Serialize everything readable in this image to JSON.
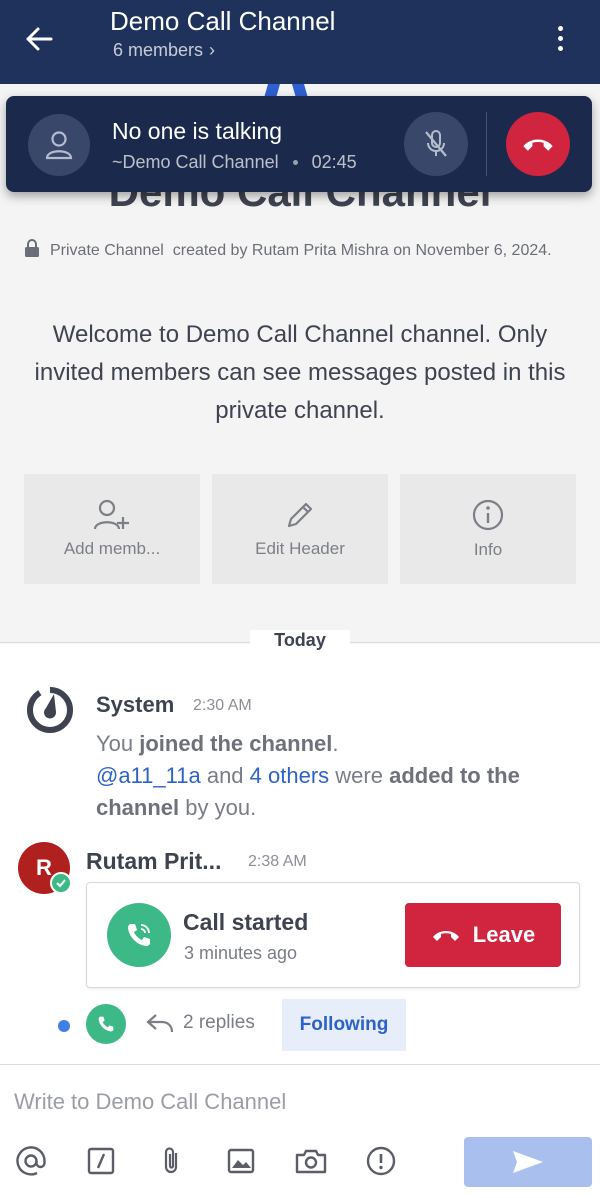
{
  "header": {
    "title": "Demo Call Channel",
    "members": "6 members",
    "chevron": "›",
    "color": "#1e325c"
  },
  "call_bar": {
    "title": "No one is talking",
    "channel": "~Demo Call Channel",
    "duration": "02:45"
  },
  "intro": {
    "title": "Demo Call Channel",
    "private_label": "Private Channel",
    "created_text": "created by Rutam Prita Mishra on November 6, 2024.",
    "welcome": "Welcome to Demo Call Channel channel. Only invited members can see messages posted in this private channel.",
    "actions": [
      {
        "label": "Add memb...",
        "icon": "add-member-icon"
      },
      {
        "label": "Edit Header",
        "icon": "pencil-icon"
      },
      {
        "label": "Info",
        "icon": "info-icon"
      }
    ]
  },
  "date_separator": "Today",
  "posts": {
    "system": {
      "name": "System",
      "time": "2:30 AM",
      "you": "You ",
      "joined": "joined the channel",
      "period": ".",
      "mention": "@a11_11a",
      "and": " and ",
      "others": "4 others",
      "were": " were ",
      "added": "added to the channel",
      "by": " by you."
    },
    "rutam": {
      "initial": "R",
      "name": "Rutam Prit...",
      "time": "2:38 AM",
      "call_title": "Call started",
      "call_sub": "3 minutes ago",
      "leave": "Leave",
      "replies": "2 replies",
      "following": "Following"
    }
  },
  "compose": {
    "placeholder": "Write to Demo Call Channel"
  },
  "colors": {
    "accent": "#2d63c8",
    "danger": "#d0243f",
    "online": "#3db887"
  }
}
